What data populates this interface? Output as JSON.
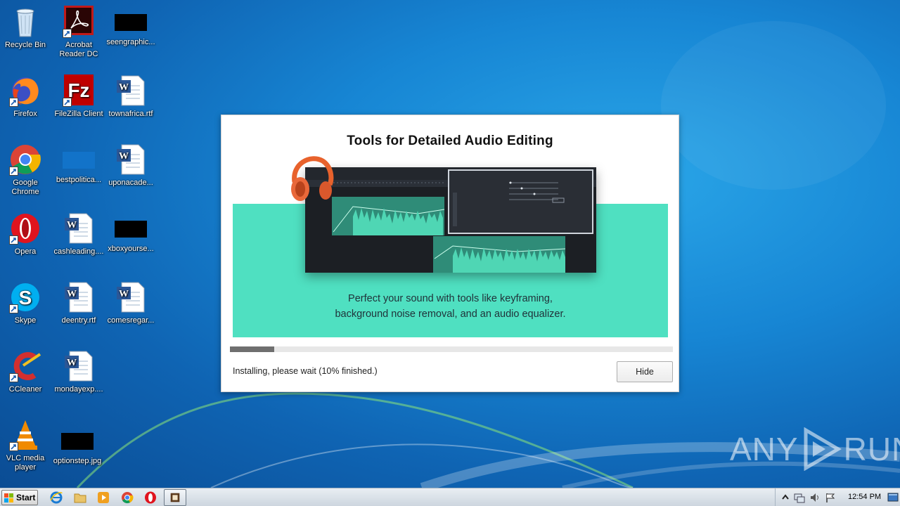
{
  "desktop": {
    "icons": [
      {
        "label": "Recycle Bin",
        "icon": "recycle-bin-icon"
      },
      {
        "label": "Acrobat Reader DC",
        "icon": "acrobat-icon"
      },
      {
        "label": "seengraphic...",
        "icon": "image-file-icon"
      },
      {
        "label": "Firefox",
        "icon": "firefox-icon"
      },
      {
        "label": "FileZilla Client",
        "icon": "filezilla-icon"
      },
      {
        "label": "townafrica.rtf",
        "icon": "word-doc-icon"
      },
      {
        "label": "Google Chrome",
        "icon": "chrome-icon"
      },
      {
        "label": "bestpolitica...",
        "icon": "image-file-icon"
      },
      {
        "label": "uponacade...",
        "icon": "word-doc-icon"
      },
      {
        "label": "Opera",
        "icon": "opera-icon"
      },
      {
        "label": "cashleading....",
        "icon": "word-doc-icon"
      },
      {
        "label": "xboxyourse...",
        "icon": "image-file-icon"
      },
      {
        "label": "Skype",
        "icon": "skype-icon"
      },
      {
        "label": "deentry.rtf",
        "icon": "word-doc-icon"
      },
      {
        "label": "comesregar...",
        "icon": "word-doc-icon"
      },
      {
        "label": "CCleaner",
        "icon": "ccleaner-icon"
      },
      {
        "label": "mondayexp....",
        "icon": "word-doc-icon"
      },
      {
        "label": "VLC media player",
        "icon": "vlc-icon"
      },
      {
        "label": "optionstep.jpg",
        "icon": "image-file-icon"
      }
    ]
  },
  "installer": {
    "title": "Tools for Detailed Audio Editing",
    "banner_line1": "Perfect your sound with tools like keyframing,",
    "banner_line2": "background noise removal, and an audio equalizer.",
    "progress_percent": 10,
    "status": "Installing, please wait (10% finished.)",
    "hide_label": "Hide"
  },
  "watermark": {
    "left": "ANY",
    "right": "RUN"
  },
  "taskbar": {
    "start_label": "Start",
    "clock": "12:54 PM",
    "pinned": [
      "internet-explorer-icon",
      "folder-icon",
      "media-player-icon",
      "chrome-icon",
      "opera-icon",
      "installer-app-icon"
    ]
  },
  "colors": {
    "banner": "#4fe0c1",
    "progress_fill": "#6f6f6f",
    "desktop_blue": "#1786d4"
  }
}
